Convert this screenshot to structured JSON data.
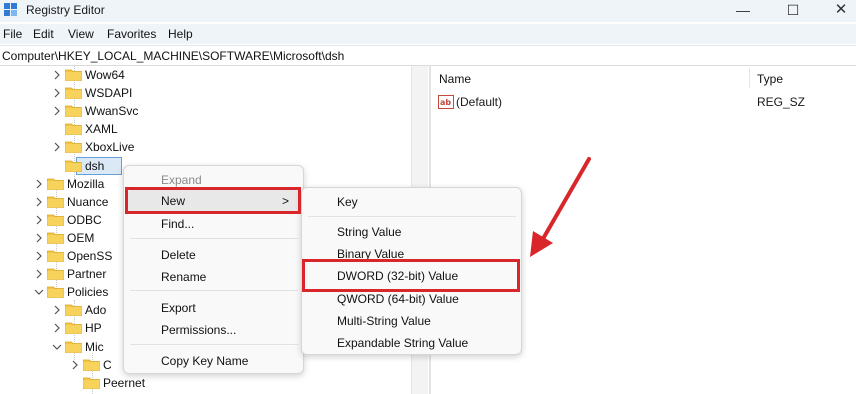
{
  "window": {
    "title": "Registry Editor",
    "controls": {
      "minimize": "—",
      "maximize": "☐",
      "close": "✕"
    }
  },
  "menubar": {
    "items": [
      "File",
      "Edit",
      "View",
      "Favorites",
      "Help"
    ]
  },
  "address": {
    "path": "Computer\\HKEY_LOCAL_MACHINE\\SOFTWARE\\Microsoft\\dsh"
  },
  "tree": {
    "items": [
      {
        "label": "Wow64",
        "expand": "collapsed"
      },
      {
        "label": "WSDAPI",
        "expand": "collapsed"
      },
      {
        "label": "WwanSvc",
        "expand": "collapsed"
      },
      {
        "label": "XAML",
        "expand": "none"
      },
      {
        "label": "XboxLive",
        "expand": "collapsed"
      },
      {
        "label": "dsh",
        "expand": "none",
        "selected": true
      },
      {
        "label": "Mozilla",
        "expand": "collapsed"
      },
      {
        "label": "Nuance",
        "expand": "collapsed"
      },
      {
        "label": "ODBC",
        "expand": "collapsed"
      },
      {
        "label": "OEM",
        "expand": "collapsed"
      },
      {
        "label": "OpenSS",
        "expand": "collapsed"
      },
      {
        "label": "Partner",
        "expand": "collapsed"
      },
      {
        "label": "Policies",
        "expand": "expanded"
      },
      {
        "label": "Ado",
        "expand": "collapsed"
      },
      {
        "label": "HP",
        "expand": "collapsed"
      },
      {
        "label": "Mic",
        "expand": "expanded"
      },
      {
        "label": "C",
        "expand": "collapsed"
      },
      {
        "label": "Peernet",
        "expand": "none"
      }
    ]
  },
  "list": {
    "columns": {
      "name": "Name",
      "type": "Type"
    },
    "rows": [
      {
        "icon": "string-value-icon",
        "name": "(Default)",
        "type": "REG_SZ"
      }
    ]
  },
  "context_menu": {
    "items": [
      {
        "label": "Expand",
        "disabled": true
      },
      {
        "label": "New",
        "submenu": true,
        "highlighted": true,
        "arrow": ">"
      },
      {
        "label": "Find..."
      },
      {
        "label": "Delete"
      },
      {
        "label": "Rename"
      },
      {
        "label": "Export"
      },
      {
        "label": "Permissions..."
      },
      {
        "label": "Copy Key Name"
      }
    ]
  },
  "new_submenu": {
    "items": [
      {
        "label": "Key"
      },
      {
        "label": "String Value"
      },
      {
        "label": "Binary Value"
      },
      {
        "label": "DWORD (32-bit) Value",
        "highlighted": true
      },
      {
        "label": "QWORD (64-bit) Value"
      },
      {
        "label": "Multi-String Value"
      },
      {
        "label": "Expandable String Value"
      }
    ]
  },
  "colors": {
    "annotation_red": "#d9262b",
    "folder_yellow": "#f4c542",
    "selection_blue": "#dbe9f7",
    "titlebar_bg": "#eff4f9"
  }
}
